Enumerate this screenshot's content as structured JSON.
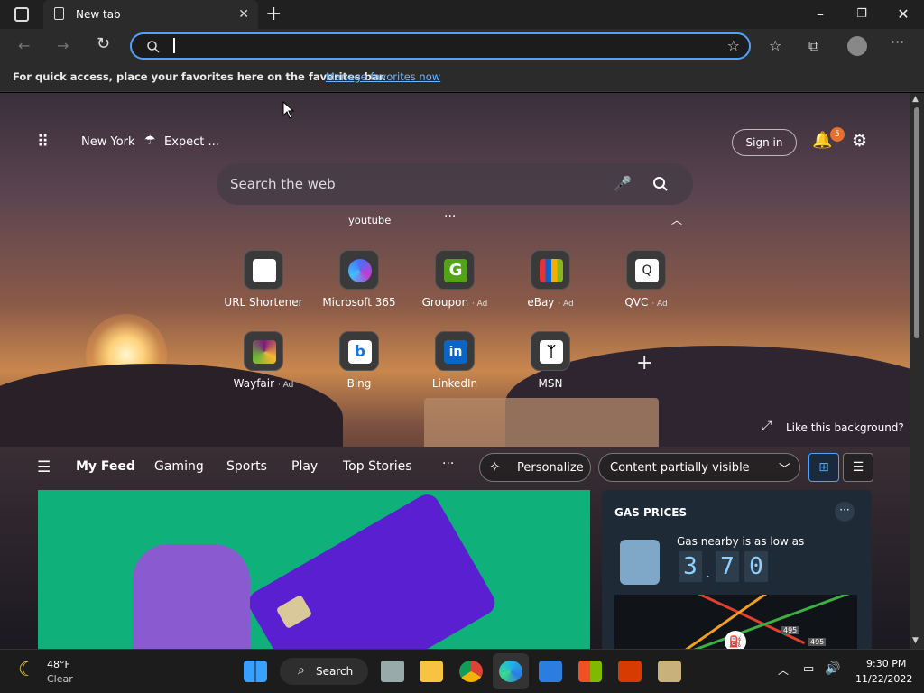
{
  "browser": {
    "tab_title": "New tab",
    "address_value": "",
    "favbar_text": "For quick access, place your favorites here on the favorites bar.",
    "favbar_link": "Manage favorites now"
  },
  "page": {
    "location": "New York",
    "weather_short": "Expect ...",
    "sign_in": "Sign in",
    "notification_count": "5",
    "search_placeholder": "Search the web",
    "trending": [
      "youtube"
    ],
    "quick_links": [
      {
        "label": "URL Shortener",
        "ad": ""
      },
      {
        "label": "Microsoft 365",
        "ad": ""
      },
      {
        "label": "Groupon",
        "ad": "Ad"
      },
      {
        "label": "eBay",
        "ad": "Ad"
      },
      {
        "label": "QVC",
        "ad": "Ad"
      },
      {
        "label": "Wayfair",
        "ad": "Ad"
      },
      {
        "label": "Bing",
        "ad": ""
      },
      {
        "label": "LinkedIn",
        "ad": ""
      },
      {
        "label": "MSN",
        "ad": ""
      }
    ],
    "like_background": "Like this background?",
    "feed_tabs": [
      "My Feed",
      "Gaming",
      "Sports",
      "Play",
      "Top Stories"
    ],
    "personalize": "Personalize",
    "content_visibility": "Content partially visible",
    "gas": {
      "title": "GAS PRICES",
      "subtitle": "Gas nearby is as low as",
      "digits": [
        "3",
        "7",
        "0"
      ],
      "map_labels": [
        "495",
        "495"
      ]
    }
  },
  "taskbar": {
    "temp": "48°F",
    "condition": "Clear",
    "search": "Search",
    "time": "9:30 PM",
    "date": "11/22/2022"
  },
  "colors": {
    "accent": "#4ea3ff",
    "badge": "#e8702a",
    "card_green": "#0fb07a",
    "card_purple": "#5a1fd0"
  }
}
